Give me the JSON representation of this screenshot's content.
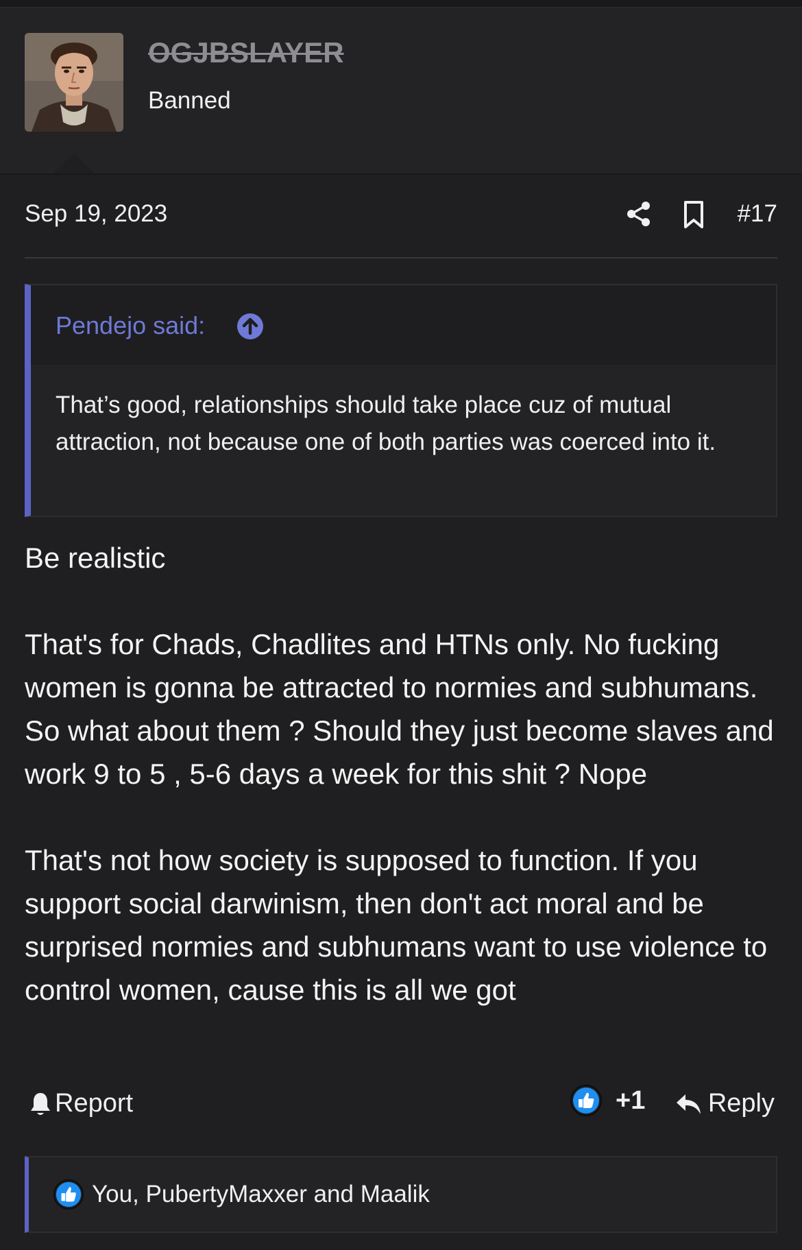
{
  "user": {
    "username": "OGJBSLAYER",
    "title": "Banned"
  },
  "post": {
    "date": "Sep 19, 2023",
    "number": "#17"
  },
  "quote": {
    "author": "Pendejo said:",
    "text": "That’s good, relationships should take place cuz of mutual attraction, not because one of both parties was coerced into it."
  },
  "body": {
    "paragraphs": [
      "Be realistic",
      "That's for Chads, Chadlites and HTNs only. No fucking women is gonna be attracted to normies and subhumans. So what about them ? Should they just become slaves and work 9 to 5 , 5-6 days a week for this shit ? Nope",
      "That's not how society is supposed to function. If you support social darwinism, then don't act moral and be surprised normies and subhumans want to use violence to control women, cause this is all we got"
    ]
  },
  "actions": {
    "report_label": "Report",
    "like_count": "+1",
    "reply_label": "Reply"
  },
  "reactions": {
    "text": "You, PubertyMaxxer and Maalik"
  },
  "icons": {
    "share": "share-icon",
    "bookmark": "bookmark-icon",
    "quote_jump": "arrow-up-circle-icon",
    "report": "bell-icon",
    "like": "thumbs-up-icon",
    "reply": "reply-arrow-icon"
  },
  "colors": {
    "background": "#1f1f21",
    "header_background": "#232326",
    "accent": "#5c63c4",
    "quote_author": "#6f79d6",
    "like_blue": "#1f8ef1",
    "username_muted": "#8e8e92"
  }
}
